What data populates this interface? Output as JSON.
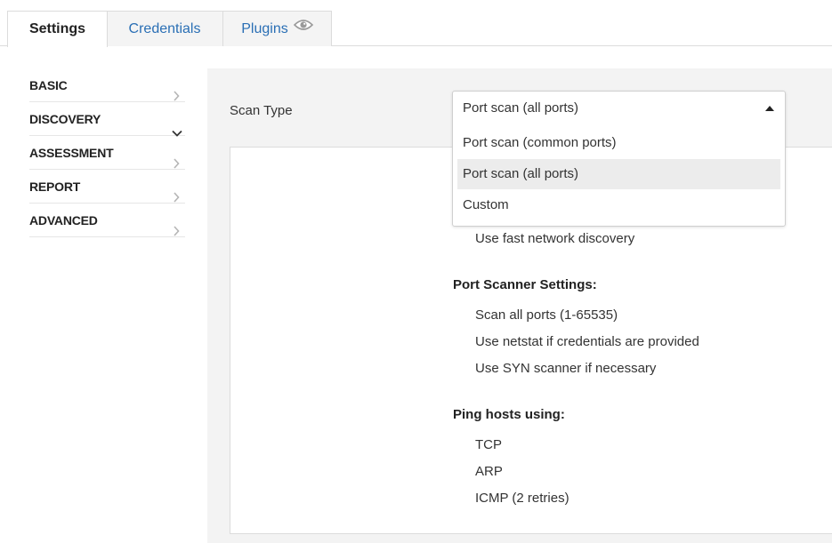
{
  "tabs": [
    {
      "label": "Settings",
      "active": true
    },
    {
      "label": "Credentials",
      "active": false
    },
    {
      "label": "Plugins",
      "active": false
    }
  ],
  "sidebar": {
    "items": [
      {
        "label": "BASIC",
        "expanded": false
      },
      {
        "label": "DISCOVERY",
        "expanded": true
      },
      {
        "label": "ASSESSMENT",
        "expanded": false
      },
      {
        "label": "REPORT",
        "expanded": false
      },
      {
        "label": "ADVANCED",
        "expanded": false
      }
    ]
  },
  "scan_type": {
    "label": "Scan Type",
    "selected": "Port scan (all ports)",
    "options": [
      {
        "label": "Port scan (common ports)",
        "highlighted": false
      },
      {
        "label": "Port scan (all ports)",
        "highlighted": true
      },
      {
        "label": "Custom",
        "highlighted": false
      }
    ]
  },
  "discovery_settings": {
    "general_line": "Use fast network discovery",
    "port_scanner": {
      "heading": "Port Scanner Settings:",
      "lines": [
        "Scan all ports (1-65535)",
        "Use netstat if credentials are provided",
        "Use SYN scanner if necessary"
      ]
    },
    "ping_hosts": {
      "heading": "Ping hosts using:",
      "lines": [
        "TCP",
        "ARP",
        "ICMP (2 retries)"
      ]
    }
  },
  "colors": {
    "link": "#2a6fb5",
    "panel_bg": "#f3f3f3",
    "highlight": "#ececec"
  },
  "icons": {
    "plugins_tab": "eye-icon",
    "sidebar_collapsed": "chevron-right-icon",
    "sidebar_expanded": "chevron-down-icon",
    "dropdown": "caret-up-icon"
  }
}
